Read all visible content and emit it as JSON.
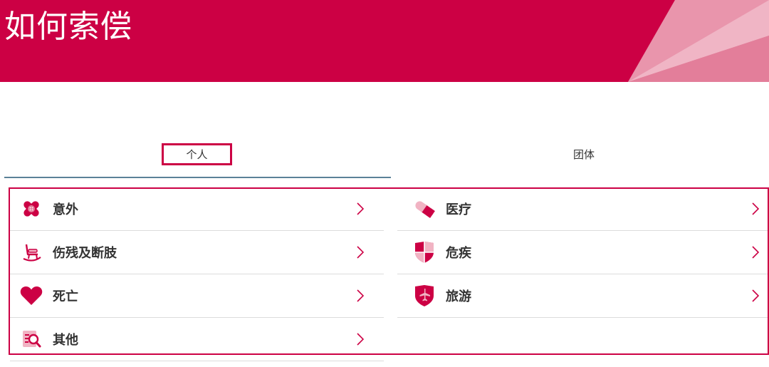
{
  "banner": {
    "title": "如何索偿"
  },
  "tabs": [
    {
      "label": "个人",
      "active": true
    },
    {
      "label": "团体",
      "active": false
    }
  ],
  "claims": {
    "left": [
      {
        "label": "意外",
        "icon": "bandage-icon"
      },
      {
        "label": "伤残及断肢",
        "icon": "rocking-chair-icon"
      },
      {
        "label": "死亡",
        "icon": "heart-icon"
      },
      {
        "label": "其他",
        "icon": "document-search-icon"
      }
    ],
    "right": [
      {
        "label": "医疗",
        "icon": "pill-icon"
      },
      {
        "label": "危疾",
        "icon": "shield-quadrant-icon"
      },
      {
        "label": "旅游",
        "icon": "shield-plane-icon"
      }
    ]
  },
  "colors": {
    "brand": "#cc0044",
    "accent_light": "#f1b3c3",
    "tab_underline": "#5b8198",
    "divider": "#dcdcdc"
  }
}
